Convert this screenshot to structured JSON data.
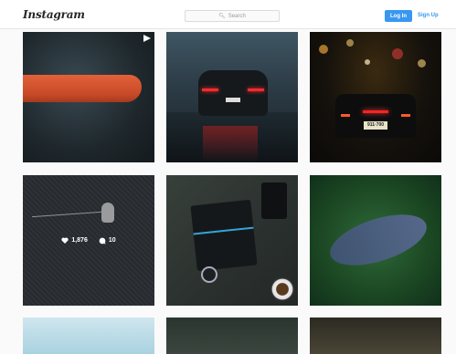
{
  "header": {
    "logo": "Instagram",
    "search_placeholder": "Search",
    "login_label": "Log In",
    "signup_label": "Sign Up"
  },
  "posts": [
    {
      "subject": "salmon fillet",
      "is_video": true
    },
    {
      "subject": "car rear lights on wet road"
    },
    {
      "subject": "sports car at night",
      "plate": "911·700"
    },
    {
      "subject": "earphones on knit",
      "likes": "1,876",
      "comments": "10",
      "hovered": true
    },
    {
      "subject": "laptop flatlay"
    },
    {
      "subject": "forest road aerial"
    },
    {
      "subject": "light sky"
    },
    {
      "subject": "wood texture"
    },
    {
      "subject": "bokeh"
    }
  ],
  "colors": {
    "accent": "#3897f0",
    "background": "#fafafa",
    "header_border": "#e6e6e6"
  }
}
